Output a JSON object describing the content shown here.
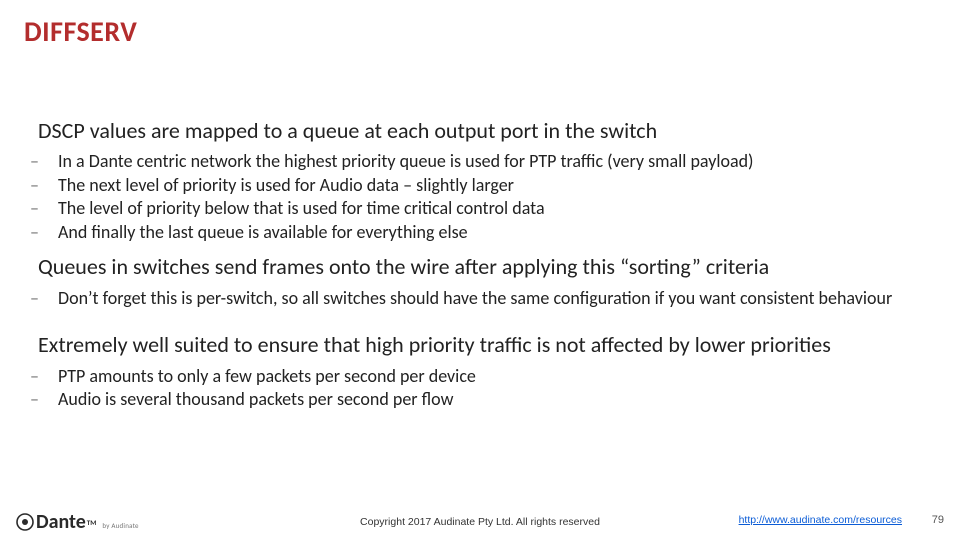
{
  "title": "DIFFSERV",
  "sections": [
    {
      "lead": "DSCP values are mapped to a queue at each output port in the switch",
      "subs": [
        "In a Dante centric network the highest priority queue is used for PTP traffic (very small payload)",
        "The next level of priority is used for Audio data – slightly larger",
        "The level of priority below that is used for time critical control data",
        "And finally the last queue is available for everything else"
      ]
    },
    {
      "lead": "Queues in switches send frames onto the wire after applying this “sorting” criteria",
      "subs": [
        "Don’t forget this is per-switch, so all switches should have the same configuration if you want consistent behaviour"
      ]
    },
    {
      "lead": "Extremely well suited to ensure that high priority traffic is not affected by lower priorities",
      "subs": [
        "PTP amounts to only a few packets per second per device",
        "Audio is several thousand packets per second per flow"
      ]
    }
  ],
  "footer": {
    "logo_text": "Dante",
    "logo_tm": "TM",
    "logo_by": "by Audinate",
    "copyright": "Copyright 2017 Audinate Pty Ltd. All rights reserved",
    "link_text": "http://www.audinate.com/resources",
    "page": "79"
  }
}
